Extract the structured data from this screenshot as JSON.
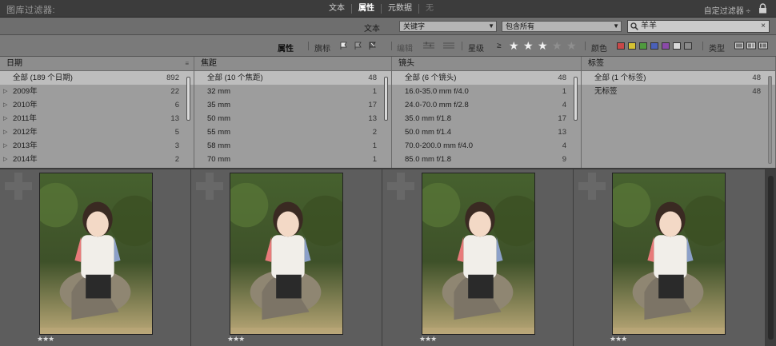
{
  "filterbar": {
    "title": "图库过滤器:",
    "modes": [
      "文本",
      "属性",
      "元数据",
      "无"
    ],
    "preset": "自定过滤器 ÷"
  },
  "textrow": {
    "label": "文本",
    "field": "关键字",
    "rule": "包含所有",
    "query": "羊羊"
  },
  "attrrow": {
    "attr": "属性",
    "flag": "旗标",
    "edit": "编辑",
    "rating": "星级",
    "rating_op": "≥",
    "rating_value": 3,
    "color": "颜色",
    "type": "类型",
    "color_swatches": [
      "#c84848",
      "#d6c233",
      "#4f9a3e",
      "#4a60b8",
      "#8a4aa8",
      "#d9d9d9",
      "#8a8a8a"
    ]
  },
  "columns": [
    {
      "header": "日期",
      "rows": [
        {
          "label": "全部 (189 个日期)",
          "count": "892",
          "tri": false
        },
        {
          "label": "2009年",
          "count": "22",
          "tri": true
        },
        {
          "label": "2010年",
          "count": "6",
          "tri": true
        },
        {
          "label": "2011年",
          "count": "13",
          "tri": true
        },
        {
          "label": "2012年",
          "count": "5",
          "tri": true
        },
        {
          "label": "2013年",
          "count": "3",
          "tri": true
        },
        {
          "label": "2014年",
          "count": "2",
          "tri": true
        }
      ]
    },
    {
      "header": "焦距",
      "rows": [
        {
          "label": "全部 (10 个焦距)",
          "count": "48"
        },
        {
          "label": "32 mm",
          "count": "1"
        },
        {
          "label": "35 mm",
          "count": "17"
        },
        {
          "label": "50 mm",
          "count": "13"
        },
        {
          "label": "55 mm",
          "count": "2"
        },
        {
          "label": "58 mm",
          "count": "1"
        },
        {
          "label": "70 mm",
          "count": "1"
        }
      ]
    },
    {
      "header": "镜头",
      "rows": [
        {
          "label": "全部 (6 个镜头)",
          "count": "48"
        },
        {
          "label": "16.0-35.0 mm f/4.0",
          "count": "1"
        },
        {
          "label": "24.0-70.0 mm f/2.8",
          "count": "4"
        },
        {
          "label": "35.0 mm f/1.8",
          "count": "17"
        },
        {
          "label": "50.0 mm f/1.4",
          "count": "13"
        },
        {
          "label": "70.0-200.0 mm f/4.0",
          "count": "4"
        },
        {
          "label": "85.0 mm f/1.8",
          "count": "9"
        }
      ]
    },
    {
      "header": "标签",
      "rows": [
        {
          "label": "全部 (1 个标签)",
          "count": "48"
        },
        {
          "label": "无标签",
          "count": "48"
        }
      ]
    }
  ],
  "photos": [
    {
      "rating": "★★★"
    },
    {
      "rating": "★★★"
    },
    {
      "rating": "★★★"
    },
    {
      "rating": "★★★"
    }
  ]
}
